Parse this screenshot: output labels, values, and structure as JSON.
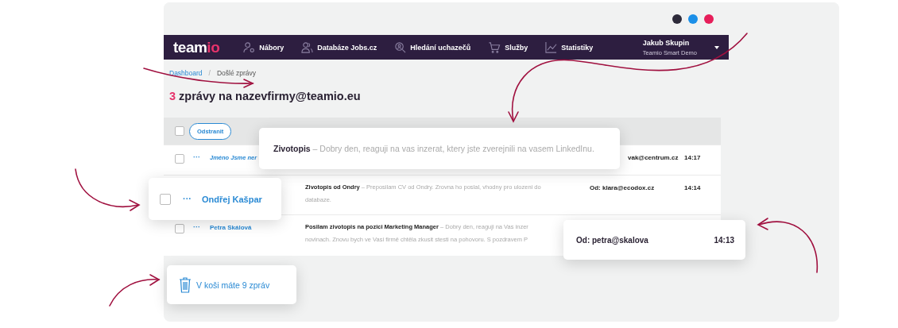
{
  "window_dots": [
    {
      "color": "#2d2a3a"
    },
    {
      "color": "#1b8fe8"
    },
    {
      "color": "#e61e5a"
    }
  ],
  "nav": {
    "logo_main": "team",
    "logo_accent": "io",
    "items": [
      {
        "kind": "users",
        "label": "Nábory"
      },
      {
        "kind": "people",
        "label": "Databáze Jobs.cz"
      },
      {
        "kind": "search",
        "label": "Hledání uchazečů"
      },
      {
        "kind": "cart",
        "label": "Služby"
      },
      {
        "kind": "chart",
        "label": "Statistiky"
      }
    ],
    "user": {
      "name": "Jakub Skupin",
      "account": "Teamio Smart Demo"
    }
  },
  "breadcrumb": {
    "link": "Dashboard",
    "separator": "/",
    "current": "Došlé zprávy"
  },
  "title": {
    "count": "3",
    "text": "zprávy na nazevfirmy@teamio.eu"
  },
  "toolbar": {
    "select_all_checked": false,
    "delete_button": "Odstranit"
  },
  "messages": [
    {
      "checked": false,
      "more": "···",
      "name": "Jméno Jsme ner",
      "from": "vak@centrum.cz",
      "time": "14:17"
    },
    {
      "subject": "Zivotopis od Ondry",
      "preview_lines": [
        "– Preposilam CV od Ondry. Zrovna ho poslal, vhodny pro ulozeni do",
        "databaze."
      ],
      "from": "Od: klara@ecodox.cz",
      "time": "14:14"
    },
    {
      "checked": false,
      "more": "···",
      "name": "Petra Skálová",
      "subject": "Posilam zivotopis na pozici Marketing Manager",
      "preview_lines": [
        "– Dobry den, reaguji na Vas inzer",
        "novinach. Znovu bych ve Vasi firmě chtěla zkusit stesti na pohovoru. S pozdravem P"
      ]
    }
  ],
  "callouts": {
    "preview": "**Zivotopis** – Dobry den, reaguji na vas inzerat, ktery jste zverejnili na vasem LinkedInu.",
    "sender": {
      "checked": false,
      "more": "···",
      "name": "Ondřej Kašpar"
    },
    "address": {
      "from": "Od: petra@skalova",
      "time": "14:13"
    },
    "trash": "V koši máte 9 zpráv"
  }
}
